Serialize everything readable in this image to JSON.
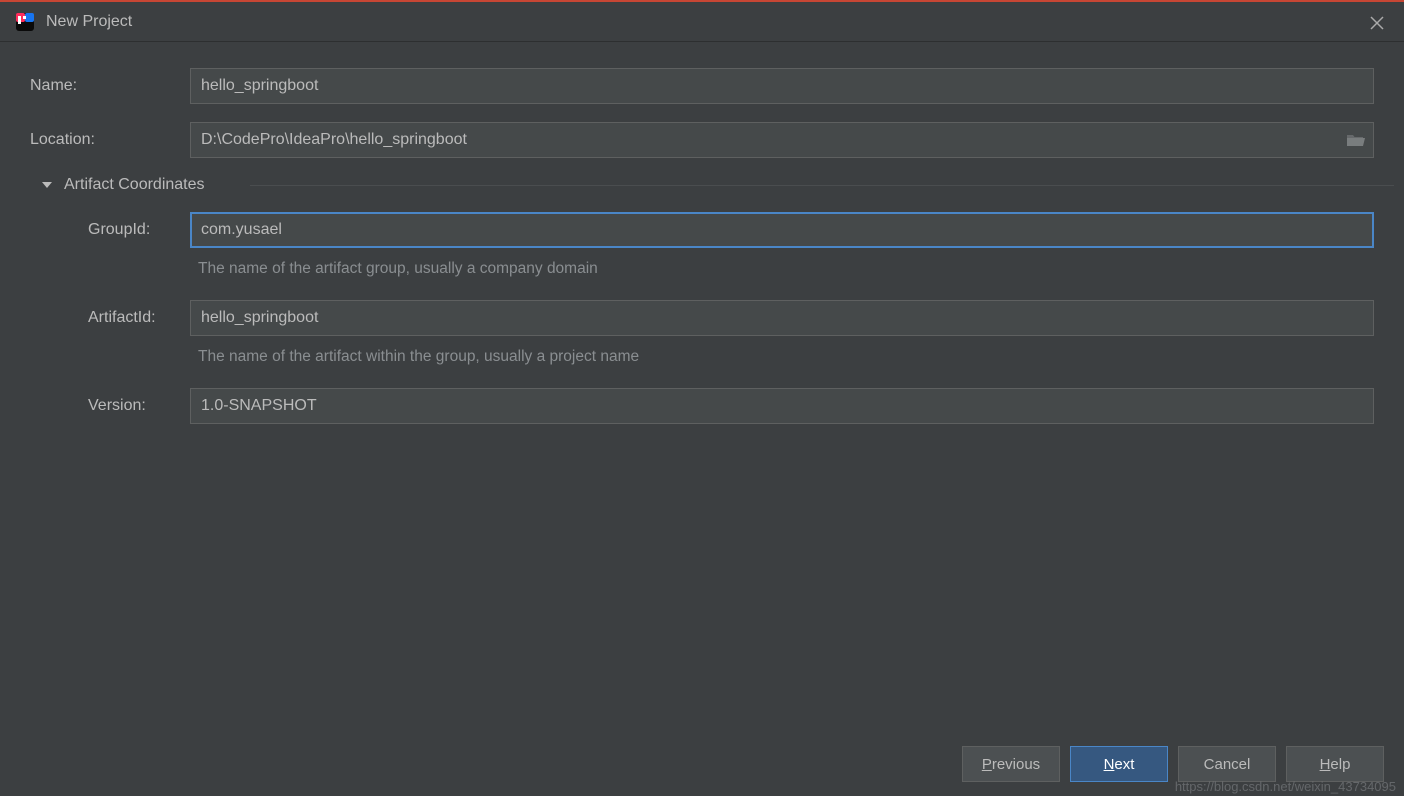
{
  "window": {
    "title": "New Project"
  },
  "fields": {
    "name_label": "Name:",
    "name_value": "hello_springboot",
    "location_label": "Location:",
    "location_value": "D:\\CodePro\\IdeaPro\\hello_springboot"
  },
  "section": {
    "title": "Artifact Coordinates"
  },
  "artifact": {
    "groupid_label": "GroupId:",
    "groupid_value": "com.yusael",
    "groupid_hint": "The name of the artifact group, usually a company domain",
    "artifactid_label": "ArtifactId:",
    "artifactid_value": "hello_springboot",
    "artifactid_hint": "The name of the artifact within the group, usually a project name",
    "version_label": "Version:",
    "version_value": "1.0-SNAPSHOT"
  },
  "buttons": {
    "previous": "Previous",
    "next": "Next",
    "cancel": "Cancel",
    "help": "Help"
  },
  "watermark": "https://blog.csdn.net/weixin_43734095"
}
